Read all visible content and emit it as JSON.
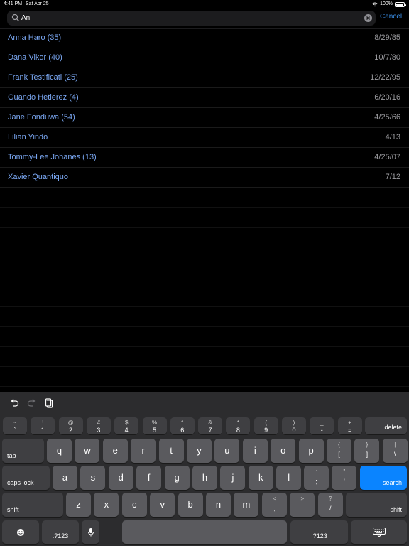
{
  "status": {
    "time": "4:41 PM",
    "date": "Sat Apr 25",
    "battery": "100%"
  },
  "search": {
    "query": "An",
    "cancel_label": "Cancel"
  },
  "results": [
    {
      "name": "Anna Haro (35)",
      "date": "8/29/85"
    },
    {
      "name": "Dana Vikor (40)",
      "date": "10/7/80"
    },
    {
      "name": "Frank Testificati (25)",
      "date": "12/22/95"
    },
    {
      "name": "Guando Hetierez (4)",
      "date": "6/20/16"
    },
    {
      "name": "Jane Fonduwa (54)",
      "date": "4/25/66"
    },
    {
      "name": "Lilian Yindo",
      "date": "4/13"
    },
    {
      "name": "Tommy-Lee Johanes (13)",
      "date": "4/25/07"
    },
    {
      "name": "Xavier Quantiquo",
      "date": "7/12"
    }
  ],
  "keyboard": {
    "row1": [
      {
        "top": "~",
        "bot": "`"
      },
      {
        "top": "!",
        "bot": "1"
      },
      {
        "top": "@",
        "bot": "2"
      },
      {
        "top": "#",
        "bot": "3"
      },
      {
        "top": "$",
        "bot": "4"
      },
      {
        "top": "%",
        "bot": "5"
      },
      {
        "top": "^",
        "bot": "6"
      },
      {
        "top": "&",
        "bot": "7"
      },
      {
        "top": "*",
        "bot": "8"
      },
      {
        "top": "(",
        "bot": "9"
      },
      {
        "top": ")",
        "bot": "0"
      },
      {
        "top": "_",
        "bot": "-"
      },
      {
        "top": "+",
        "bot": "="
      }
    ],
    "delete_label": "delete",
    "tab_label": "tab",
    "row2": [
      "q",
      "w",
      "e",
      "r",
      "t",
      "y",
      "u",
      "i",
      "o",
      "p"
    ],
    "row2_extra": [
      {
        "top": "{",
        "bot": "["
      },
      {
        "top": "}",
        "bot": "]"
      },
      {
        "top": "|",
        "bot": "\\"
      }
    ],
    "caps_label": "caps lock",
    "row3": [
      "a",
      "s",
      "d",
      "f",
      "g",
      "h",
      "j",
      "k",
      "l"
    ],
    "row3_extra": [
      {
        "top": ":",
        "bot": ";"
      },
      {
        "top": "\"",
        "bot": "'"
      }
    ],
    "search_label": "search",
    "shift_label": "shift",
    "row4": [
      "z",
      "x",
      "c",
      "v",
      "b",
      "n",
      "m"
    ],
    "row4_extra": [
      {
        "top": "<",
        "bot": ","
      },
      {
        "top": ">",
        "bot": "."
      },
      {
        "top": "?",
        "bot": "/"
      }
    ],
    "numbers_label": ".?123",
    "accent_color": "#0a84ff"
  }
}
